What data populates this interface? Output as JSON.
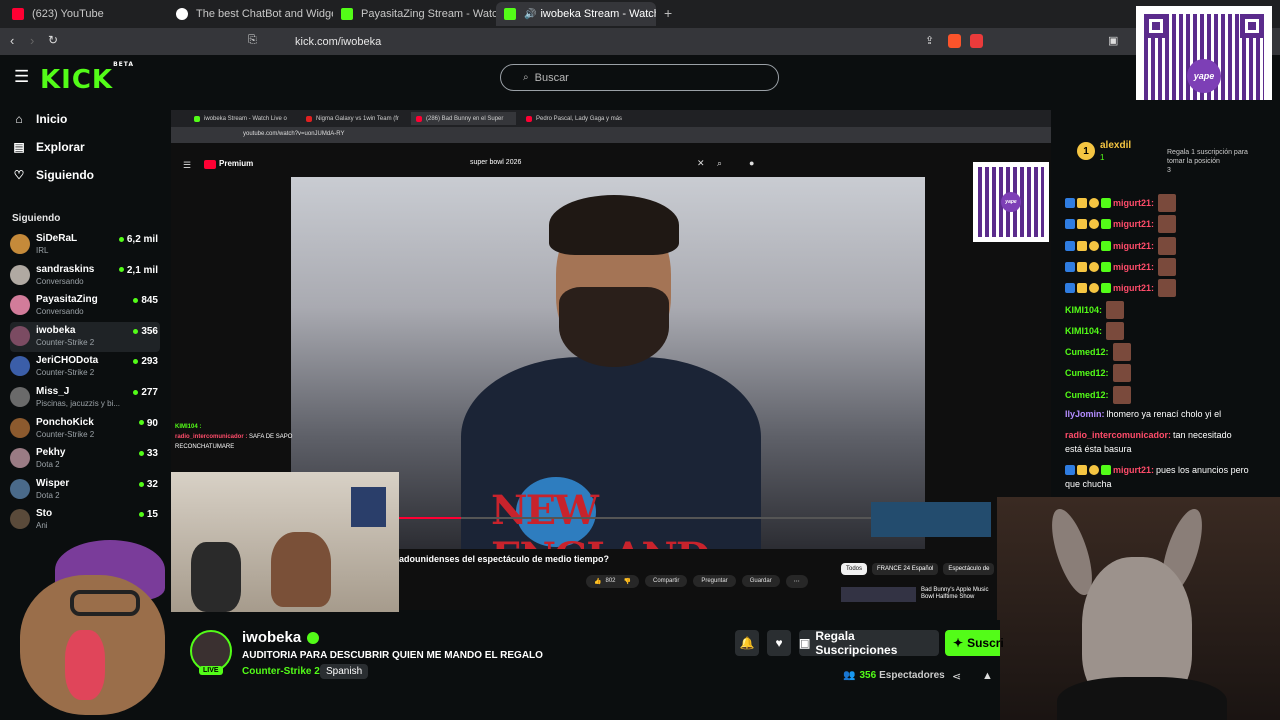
{
  "browser": {
    "tabs": [
      {
        "label": "(623) YouTube",
        "color": "#ff0033"
      },
      {
        "label": "The best ChatBot and Widgets for Ki",
        "color": "#ffffff"
      },
      {
        "label": "PayasitaZing Stream - Watch Live on",
        "color": "#53fc18"
      },
      {
        "label": "iwobeka Stream - Watch Live",
        "color": "#53fc18"
      }
    ],
    "url": "kick.com/iwobeka"
  },
  "kick": {
    "logo": "KICK",
    "logo_badge": "BETA",
    "search_placeholder": "Buscar",
    "brand_color": "#53fc18"
  },
  "sidebar": {
    "nav": [
      {
        "label": "Inicio",
        "icon": "home-icon"
      },
      {
        "label": "Explorar",
        "icon": "compass-icon"
      },
      {
        "label": "Siguiendo",
        "icon": "heart-icon"
      }
    ],
    "following_title": "Siguiendo",
    "channels": [
      {
        "name": "SiDeRaL",
        "game": "IRL",
        "viewers": "6,2 mil",
        "color": "#c58a3a"
      },
      {
        "name": "sandraskins",
        "game": "Conversando",
        "viewers": "2,1 mil",
        "color": "#b0a9a2"
      },
      {
        "name": "PayasitaZing",
        "game": "Conversando",
        "viewers": "845",
        "color": "#d27c9a"
      },
      {
        "name": "iwobeka",
        "game": "Counter-Strike 2",
        "viewers": "356",
        "color": "#7b4b62"
      },
      {
        "name": "JeriCHODota",
        "game": "Counter-Strike 2",
        "viewers": "293",
        "color": "#3b5ea8"
      },
      {
        "name": "Miss_J",
        "game": "Piscinas, jacuzzis y bi...",
        "viewers": "277",
        "color": "#6a6a6a"
      },
      {
        "name": "PonchoKick",
        "game": "Counter-Strike 2",
        "viewers": "90",
        "color": "#8c5a2e"
      },
      {
        "name": "Pekhy",
        "game": "Dota 2",
        "viewers": "33",
        "color": "#9a7b84"
      },
      {
        "name": "Wisper",
        "game": "Dota 2",
        "viewers": "32",
        "color": "#4a6a8a"
      },
      {
        "name": "Sto",
        "game": "Ani",
        "viewers": "15",
        "color": "#5a4a3a"
      }
    ]
  },
  "stream_inner": {
    "tabs": [
      "iwobeka Stream - Watch Live o",
      "Nigma Galaxy vs 1win Team (fr",
      "(286) Bad Bunny en el Super",
      "Pedro Pascal, Lady Gaga y más"
    ],
    "url": "youtube.com/watch?v=uonJUMdA-RY",
    "yt_logo": "Premium",
    "yt_search": "super bowl 2026",
    "video_title_partial": "adounidenses del espectáculo de medio tiempo?",
    "likes": "802",
    "share": "Compartir",
    "ask": "Preguntar",
    "save": "Guardar",
    "chips": [
      "Todos",
      "FRANCE 24 Español",
      "Espectáculo de"
    ],
    "related_title": "Bad Bunny's Apple Music Bowl Halftime Show",
    "overlay_chat": [
      {
        "user": "KIMI104 :",
        "text": ""
      },
      {
        "user": "radio_intercomunicador :",
        "text": "SAFA DE SAPO RECONCHATUMARE"
      }
    ],
    "jersey_text": "NEW ENGLAND"
  },
  "chat": {
    "top_user": "alexdil",
    "top_rank": "1",
    "top_count": "1",
    "promo_text": "Regala 1 suscripción para tomar la posición",
    "promo_pos": "3",
    "messages": [
      {
        "user": "migurt21:",
        "text": "",
        "color": "#ff4c6a",
        "badges": true,
        "emote": true
      },
      {
        "user": "migurt21:",
        "text": "",
        "color": "#ff4c6a",
        "badges": true,
        "emote": true
      },
      {
        "user": "migurt21:",
        "text": "",
        "color": "#ff4c6a",
        "badges": true,
        "emote": true
      },
      {
        "user": "migurt21:",
        "text": "",
        "color": "#ff4c6a",
        "badges": true,
        "emote": true
      },
      {
        "user": "migurt21:",
        "text": "",
        "color": "#ff4c6a",
        "badges": true,
        "emote": true
      },
      {
        "user": "KIMI104:",
        "text": "",
        "color": "#53fc18",
        "badges": false,
        "emote": true
      },
      {
        "user": "KIMI104:",
        "text": "",
        "color": "#53fc18",
        "badges": false,
        "emote": true
      },
      {
        "user": "Cumed12:",
        "text": "",
        "color": "#53fc18",
        "badges": false,
        "emote": true
      },
      {
        "user": "Cumed12:",
        "text": "",
        "color": "#53fc18",
        "badges": false,
        "emote": true
      },
      {
        "user": "Cumed12:",
        "text": "",
        "color": "#53fc18",
        "badges": false,
        "emote": true
      },
      {
        "user": "IlyJomin:",
        "text": "lhomero ya renací cholo yi el",
        "color": "#b38cff",
        "badges": false,
        "emote": false
      },
      {
        "user": "radio_intercomunicador:",
        "text": "tan necesitado",
        "text2": "está ésta basura",
        "color": "#ff4c6a",
        "badges": false,
        "emote": false
      },
      {
        "user": "migurt21:",
        "text": "pues los anuncios pero",
        "text2": "que chucha",
        "color": "#ff4c6a",
        "badges": true,
        "emote": false
      }
    ]
  },
  "channel": {
    "name": "iwobeka",
    "title": "AUDITORIA PARA  DESCUBRIR QUIEN ME MANDO EL REGALO",
    "category": "Counter-Strike 2",
    "language": "Spanish",
    "live_badge": "LIVE",
    "gift_subs": "Regala Suscripciones",
    "subscribe": "Suscri",
    "viewers": "356",
    "viewers_label": "Espectadores"
  },
  "qr": {
    "logo_text": "yape"
  }
}
